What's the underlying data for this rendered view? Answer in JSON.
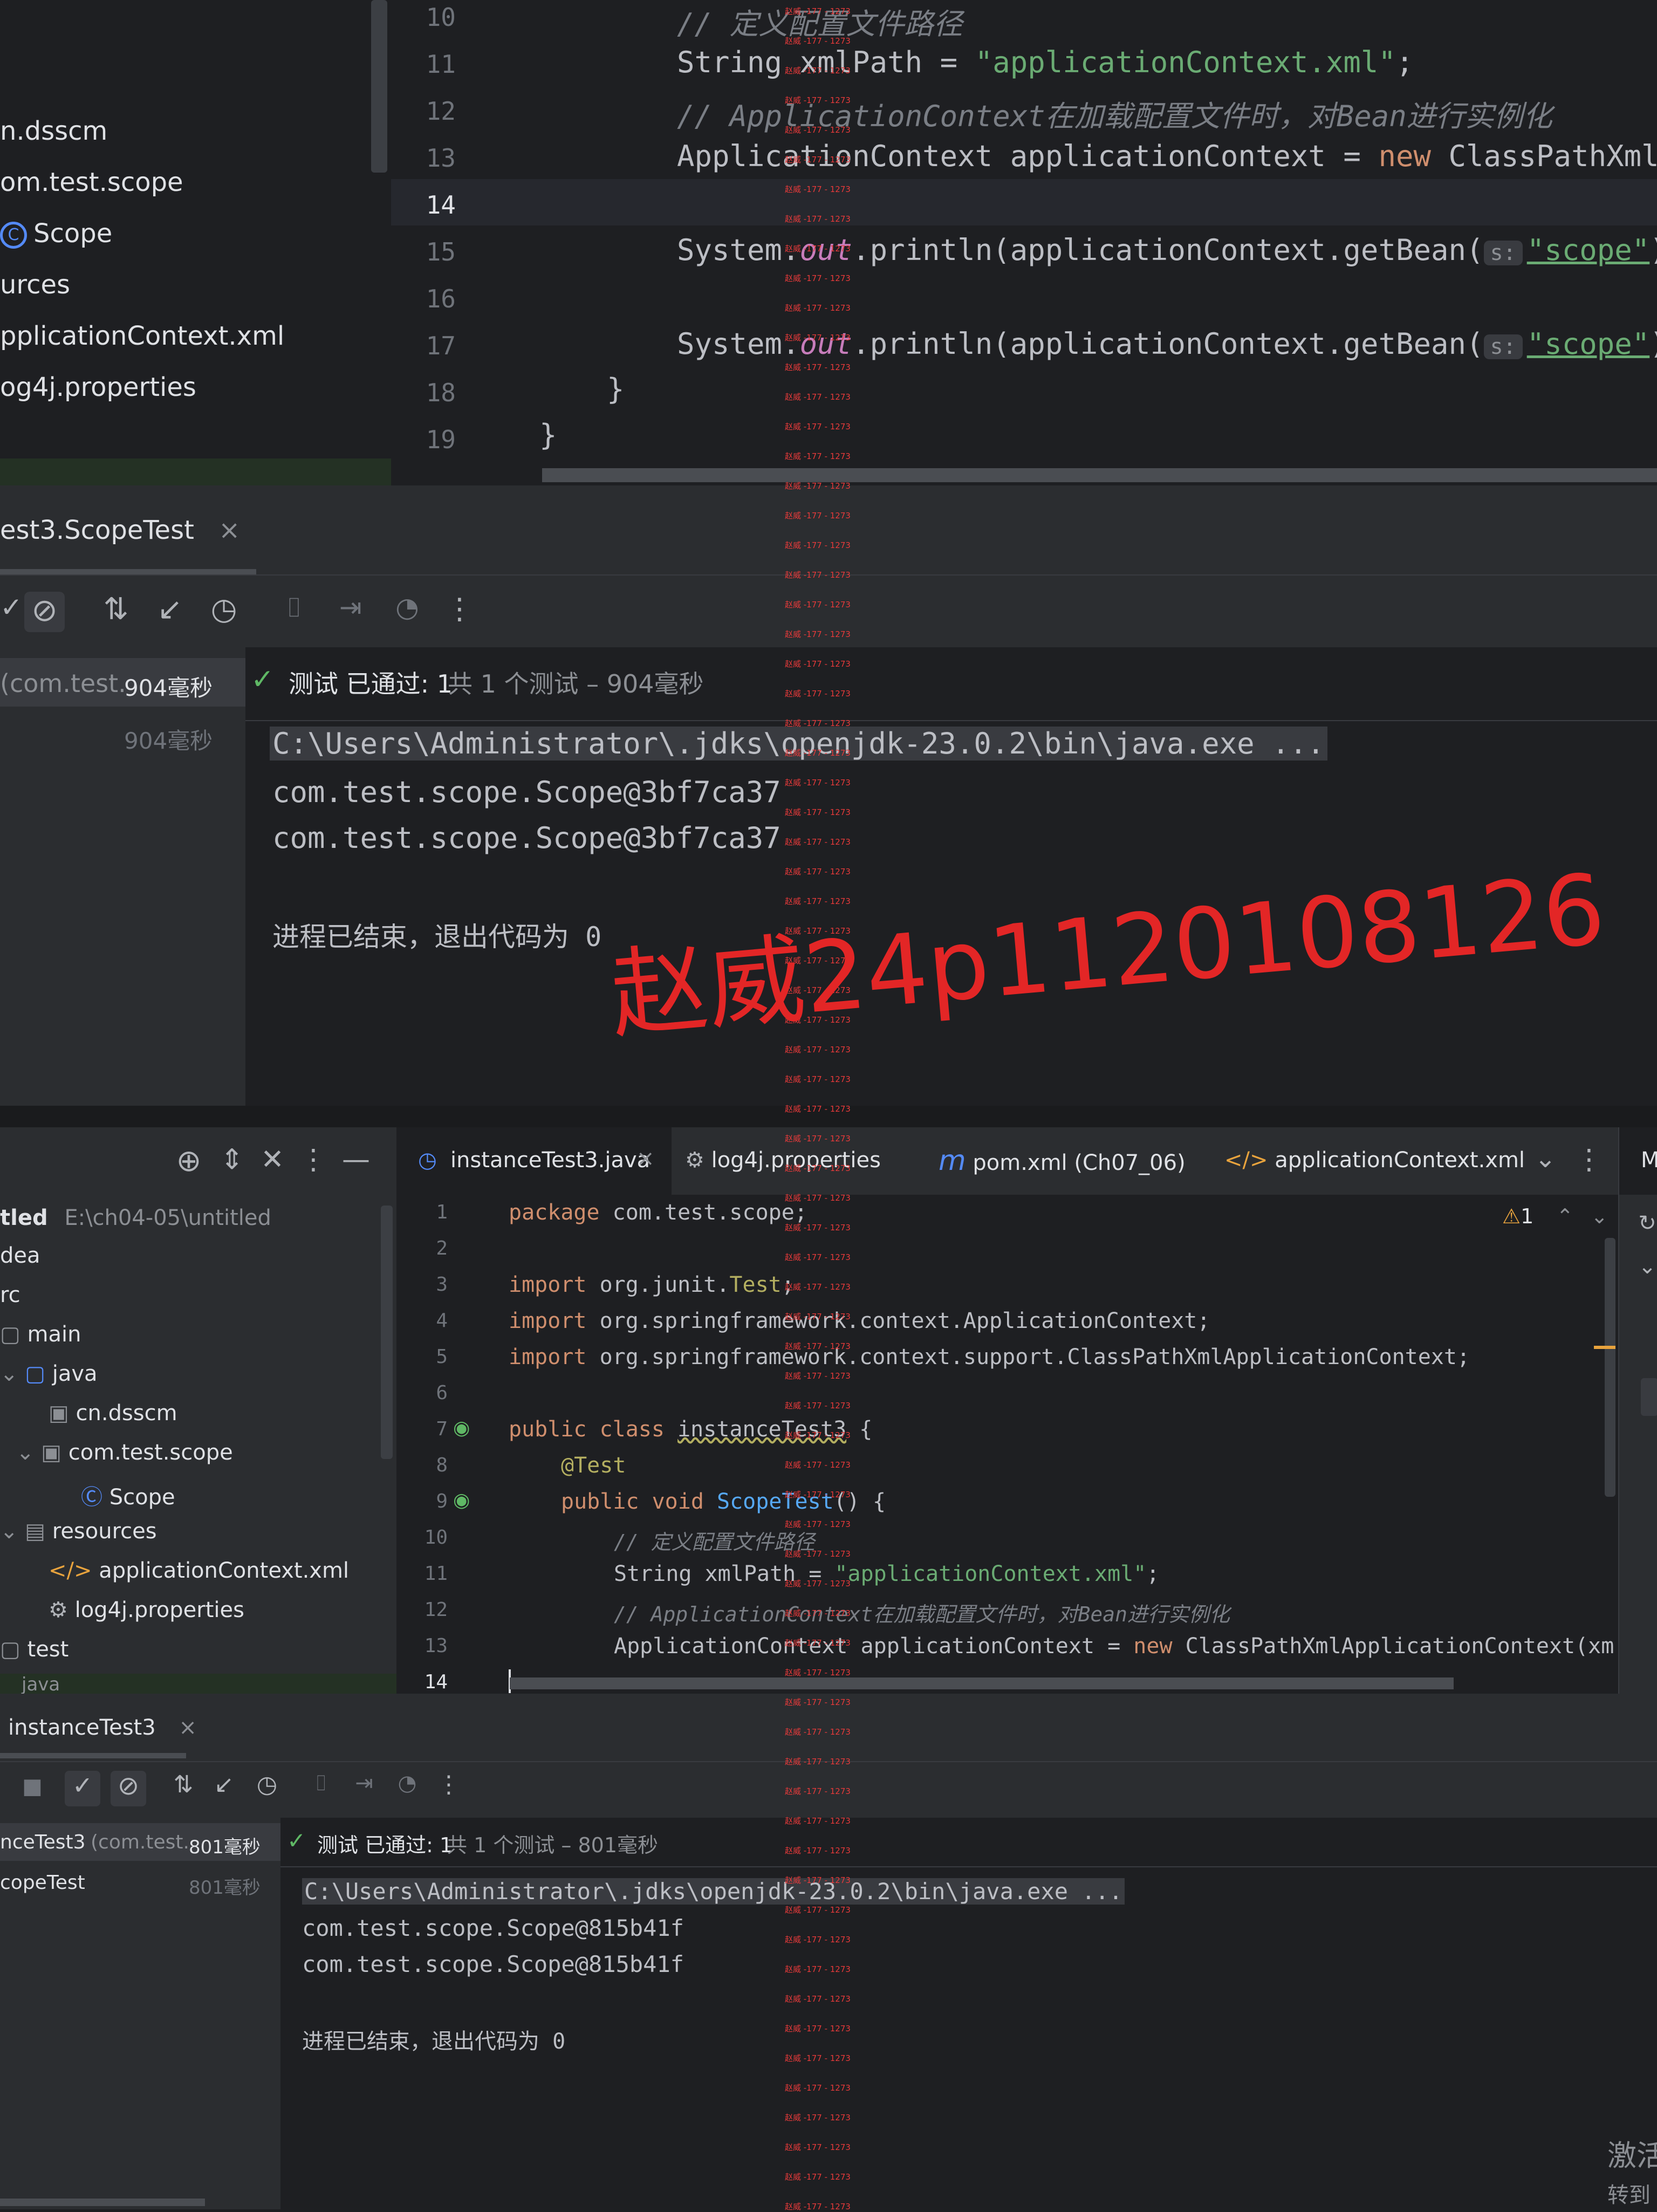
{
  "top": {
    "tree": [
      "n.dsscm",
      "om.test.scope",
      "Scope",
      "urces",
      "pplicationContext.xml",
      "og4j.properties"
    ],
    "line_numbers": [
      "10",
      "11",
      "12",
      "13",
      "14",
      "15",
      "16",
      "17",
      "18",
      "19"
    ],
    "code": {
      "l10_comment": "// 定义配置文件路径",
      "l11_a": "String xmlPath = ",
      "l11_str": "\"applicationContext.xml\"",
      "l11_b": ";",
      "l12_comment": "// ApplicationContext在加载配置文件时，对Bean进行实例化",
      "l13_a": "ApplicationContext applicationContext = ",
      "l13_new": "new",
      "l13_b": " ClassPathXmlAp",
      "l15_a": "System.",
      "l15_out": "out",
      "l15_b": ".println(applicationContext.getBean(",
      "hint": "s:",
      "l15_str": "\"scope\"",
      "l15_c": "))",
      "l18": "}",
      "l19": "}"
    },
    "run_tab": "est3.ScopeTest",
    "close": "×",
    "status_check": "✓",
    "status_label": "测试 已通过: 1",
    "status_suffix": "共 1 个测试 – 904毫秒",
    "tree_row1_name": "(com.test.",
    "tree_row1_time": "904毫秒",
    "tree_row2_time": "904毫秒",
    "console": [
      "C:\\Users\\Administrator\\.jdks\\openjdk-23.0.2\\bin\\java.exe ...",
      "com.test.scope.Scope@3bf7ca37",
      "com.test.scope.Scope@3bf7ca37",
      "",
      "进程已结束，退出代码为 0"
    ]
  },
  "watermark": {
    "big": "赵威24p1120108126",
    "small": "赵威 -177 - 1273"
  },
  "bottom": {
    "editor_tabs": [
      {
        "label": "instanceTest3.java",
        "icon": "class-icon"
      },
      {
        "label": "log4j.properties",
        "icon": "gear-icon"
      },
      {
        "label": "pom.xml (Ch07_06)",
        "icon": "maven-icon"
      },
      {
        "label": "applicationContext.xml",
        "icon": "xml-icon"
      }
    ],
    "tab_close": "×",
    "right_tab_letter": "M",
    "warning_count": "1",
    "project_root": "tled",
    "project_path": "E:\\ch04-05\\untitled",
    "tree": [
      "dea",
      "rc",
      "main",
      "java",
      "cn.dsscm",
      "com.test.scope",
      "Scope",
      "resources",
      "applicationContext.xml",
      "log4j.properties",
      "test",
      "java"
    ],
    "line_numbers": [
      "1",
      "2",
      "3",
      "4",
      "5",
      "6",
      "7",
      "8",
      "9",
      "10",
      "11",
      "12",
      "13",
      "14"
    ],
    "code": {
      "l1_kw": "package",
      "l1_rest": " com.test.scope;",
      "l3_kw": "import",
      "l3_a": " org.junit.",
      "l3_b": "Test",
      "l3_c": ";",
      "l4_kw": "import",
      "l4_rest": " org.springframework.context.ApplicationContext;",
      "l5_kw": "import",
      "l5_rest": " org.springframework.context.support.ClassPathXmlApplicationContext;",
      "l7_kw": "public class",
      "l7_name": "instanceTest3",
      "l7_b": " {",
      "l8": "@Test",
      "l9_kw": "public void",
      "l9_name": "ScopeTest",
      "l9_b": "() {",
      "l10": "// 定义配置文件路径",
      "l11_a": "String xmlPath = ",
      "l11_str": "\"applicationContext.xml\"",
      "l11_b": ";",
      "l12": "// ApplicationContext在加载配置文件时，对Bean进行实例化",
      "l13_a": "ApplicationContext applicationContext = ",
      "l13_new": "new",
      "l13_b": " ClassPathXmlApplicationContext(xm"
    },
    "run_tab": "instanceTest3",
    "status_check": "✓",
    "status_label": "测试 已通过: 1",
    "status_suffix": "共 1 个测试 – 801毫秒",
    "tree_row1_name": "nceTest3",
    "tree_row1_pkg": "(com.test.",
    "tree_row1_time": "801毫秒",
    "tree_row2_name": "copeTest",
    "tree_row2_time": "801毫秒",
    "console": [
      "C:\\Users\\Administrator\\.jdks\\openjdk-23.0.2\\bin\\java.exe ...",
      "com.test.scope.Scope@815b41f",
      "com.test.scope.Scope@815b41f",
      "",
      "进程已结束，退出代码为 0"
    ],
    "activate_text_1": "激活",
    "activate_text_2": "转到"
  }
}
